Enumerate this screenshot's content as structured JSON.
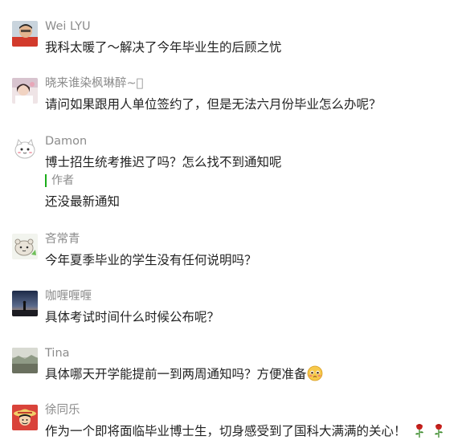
{
  "comments": [
    {
      "username": "Wei LYU",
      "text": "我科太暖了～解决了今年毕业生的后顾之忧",
      "avatar": "avatar-man-red-shirt"
    },
    {
      "username": "晓来谁染枫琳醉~􏰀",
      "text": "请问如果跟用人单位签约了，但是无法六月份毕业怎么办呢？",
      "avatar": "avatar-girl-photo"
    },
    {
      "username": "Damon",
      "text": "博士招生统考推迟了吗？怎么找不到通知呢",
      "avatar": "avatar-cartoon-cat",
      "reply": {
        "author": "作者",
        "text": "还没最新通知"
      }
    },
    {
      "username": "吝常青",
      "text": "今年夏季毕业的学生没有任何说明吗？",
      "avatar": "avatar-cartoon-bear"
    },
    {
      "username": "咖喱喱喱",
      "text": "具体考试时间什么时候公布呢？",
      "avatar": "avatar-sunset-silhouette"
    },
    {
      "username": "Tina",
      "text": "具体哪天开学能提前一到两周通知吗？方便准备",
      "avatar": "avatar-landscape",
      "trailing_emoji": "pleading-face-emoji"
    },
    {
      "username": "徐同乐",
      "text": "作为一个即将面临毕业博士生，切身感受到了国科大满满的关心！",
      "avatar": "avatar-anime-character",
      "trailing_emoji": "rose-emoji"
    }
  ],
  "colors": {
    "username": "#8c8c8c",
    "text": "#222222",
    "reply_bar": "#1aad19"
  }
}
